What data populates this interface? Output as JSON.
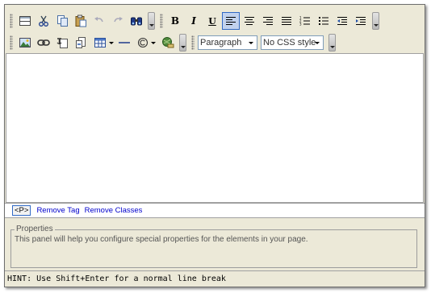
{
  "toolbar": {
    "bold_label": "B",
    "italic_label": "I",
    "underline_label": "U",
    "paragraph_select": "Paragraph",
    "css_select": "No CSS style"
  },
  "tag_bar": {
    "current_tag": "<P>",
    "remove_tag": "Remove Tag",
    "remove_classes": "Remove Classes"
  },
  "properties": {
    "legend": "Properties",
    "text": "This panel will help you configure special properties for the elements in your page."
  },
  "hint": "HINT: Use Shift+Enter for a normal line break",
  "colors": {
    "chrome": "#ece9d8",
    "active_border": "#316ac5",
    "link": "#0000cc"
  }
}
